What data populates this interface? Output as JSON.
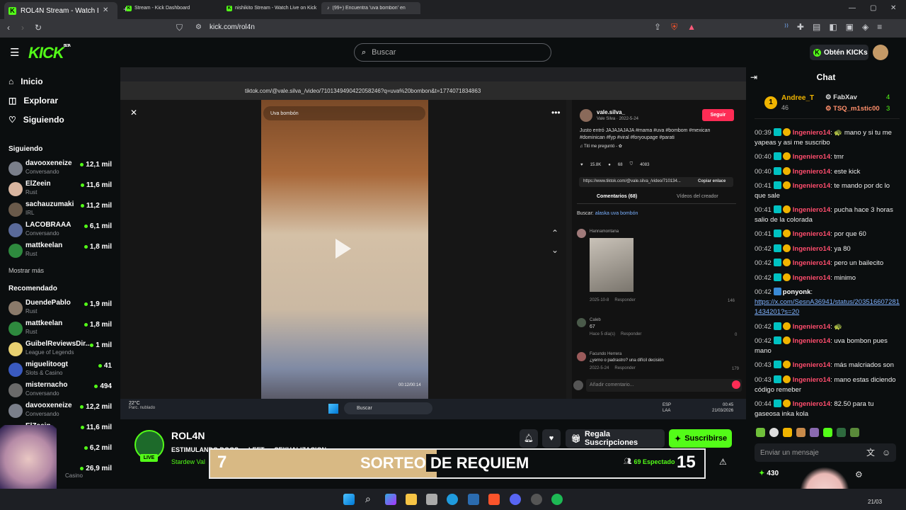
{
  "browser": {
    "tab_title": "ROL4N Stream - Watch Live o",
    "url": "kick.com/rol4n"
  },
  "header": {
    "logo": "KICK",
    "logo_sup": "BETA",
    "search_placeholder": "Buscar",
    "get_kicks": "Obtén KICKs"
  },
  "sidebar": {
    "nav": [
      {
        "label": "Inicio",
        "icon": "home-icon"
      },
      {
        "label": "Explorar",
        "icon": "compass-icon"
      },
      {
        "label": "Siguiendo",
        "icon": "heart-icon"
      }
    ],
    "following_title": "Siguiendo",
    "following": [
      {
        "name": "davooxeneize",
        "category": "Conversando",
        "viewers": "12,1 mil"
      },
      {
        "name": "ElZeein",
        "category": "Rust",
        "viewers": "11,6 mil"
      },
      {
        "name": "sachauzumaki",
        "category": "IRL",
        "viewers": "11,2 mil"
      },
      {
        "name": "LACOBRAAA",
        "category": "Conversando",
        "viewers": "6,1 mil"
      },
      {
        "name": "mattkeelan",
        "category": "Rust",
        "viewers": "1,8 mil"
      }
    ],
    "show_more": "Mostrar más",
    "recommended_title": "Recomendado",
    "recommended": [
      {
        "name": "DuendePablo",
        "category": "Rust",
        "viewers": "1,9 mil"
      },
      {
        "name": "mattkeelan",
        "category": "Rust",
        "viewers": "1,8 mil"
      },
      {
        "name": "GuibelReviewsDir...",
        "category": "League of Legends",
        "viewers": "1 mil"
      },
      {
        "name": "miguelitoogt",
        "category": "Slots & Casino",
        "viewers": "41"
      },
      {
        "name": "misternacho",
        "category": "Conversando",
        "viewers": "494"
      },
      {
        "name": "davooxeneize",
        "category": "Conversando",
        "viewers": "12,2 mil"
      },
      {
        "name": "ElZeein",
        "category": "",
        "viewers": "11,6 mil"
      },
      {
        "name": "",
        "category": "",
        "viewers": "6,2 mil"
      },
      {
        "name": "",
        "category": "Casino",
        "viewers": "26,9 mil"
      }
    ]
  },
  "inner": {
    "tabs": [
      "Stream - Kick Dashboard",
      "nishikito Stream - Watch Live on Kick",
      "(99+) Encuentra 'uva bombon' en"
    ],
    "url": "tiktok.com/@vale.silva_/video/7101349490422058246?q=uva%20bombon&t=1774071834863",
    "tk_search": "Uva bombón",
    "video_time": "00:12/00:14",
    "author": "vale.silva_",
    "author_sub": "Vale Silva · 2022-5-24",
    "follow": "Seguir",
    "caption": "Justo entró JAJAJAJAJA #mama #uva #bombom #mexican #dominican #fyp #viral #foryoupage #parati",
    "sound": "♫ Tití me preguntó - ✿",
    "likes": "15.8K",
    "comments_count": "68",
    "saves": "4083",
    "link": "https://www.tiktok.com/@vale.silva_/video/710134...",
    "copy_link": "Copiar enlace",
    "comments_tab": "Comentarios (68)",
    "videos_tab": "Vídeos del creador",
    "search_label": "Buscar: ",
    "search_term": "alaska uva bombón",
    "comments": [
      {
        "user": "Hannamontana",
        "text": "",
        "date": "2025-10-8",
        "likes": "146"
      },
      {
        "user": "Caleb",
        "text": "67",
        "date": "Hace 5 día(s)",
        "likes": "0"
      },
      {
        "user": "Facundo Herrera",
        "text": "¿yerno o padrastro? una difícil decisión",
        "date": "2022-5-24",
        "likes": "179"
      }
    ],
    "reply": "Responder",
    "add_comment": "Añadir comentario...",
    "weather_temp": "22°C",
    "weather_desc": "Parc. nublado",
    "win_search": "Buscar",
    "lang": "ESP",
    "lang2": "LAA",
    "time": "00:45",
    "date": "21/03/2026"
  },
  "stream": {
    "name": "ROL4N",
    "title": "ESTIMULANDO DOGS → LEFT → SEXUALIZACION",
    "category": "Stardew Val",
    "live": "LIVE",
    "gift": "Regala Suscripciones",
    "subscribe": "Suscribirse",
    "viewers": "69 Espectado",
    "raffle_left": "7",
    "raffle_text_a": "SORTEO",
    "raffle_text_b": " DE REQUIEM",
    "raffle_right": "15"
  },
  "chat": {
    "title": "Chat",
    "leaders": [
      {
        "name": "Andree_T",
        "value": "46"
      },
      {
        "name": "FabXav",
        "value": "4"
      },
      {
        "name": "TSQ_m1stic00",
        "value": "3"
      }
    ],
    "messages": [
      {
        "time": "00:39",
        "user": "Ingeniero14",
        "text": "🐢 mano y si tu me yapeas y asi me suscribo"
      },
      {
        "time": "00:40",
        "user": "Ingeniero14",
        "text": "tmr"
      },
      {
        "time": "00:40",
        "user": "Ingeniero14",
        "text": "este kick"
      },
      {
        "time": "00:41",
        "user": "Ingeniero14",
        "text": "te mando por dc lo que sale"
      },
      {
        "time": "00:41",
        "user": "Ingeniero14",
        "text": "pucha hace 3 horas salio de la colorada"
      },
      {
        "time": "00:41",
        "user": "Ingeniero14",
        "text": "por que 60"
      },
      {
        "time": "00:42",
        "user": "Ingeniero14",
        "text": "ya 80"
      },
      {
        "time": "00:42",
        "user": "Ingeniero14",
        "text": "pero un bailecito"
      },
      {
        "time": "00:42",
        "user": "Ingeniero14",
        "text": "minimo"
      },
      {
        "time": "00:42",
        "user": "ponyonk",
        "text": "https://x.com/SesnA36941/status/2035166072811434201?s=20"
      },
      {
        "time": "00:42",
        "user": "Ingeniero14",
        "text": "🐢"
      },
      {
        "time": "00:42",
        "user": "Ingeniero14",
        "text": "uva bombon pues mano"
      },
      {
        "time": "00:43",
        "user": "Ingeniero14",
        "text": "más malcriados son"
      },
      {
        "time": "00:43",
        "user": "Ingeniero14",
        "text": "mano estas diciendo código remeber"
      },
      {
        "time": "00:44",
        "user": "Ingeniero14",
        "text": "82.50 para tu gaseosa inka kola"
      }
    ],
    "input_placeholder": "Enviar un mensaje",
    "points": "430"
  },
  "taskbar": {
    "time": "21/03"
  }
}
